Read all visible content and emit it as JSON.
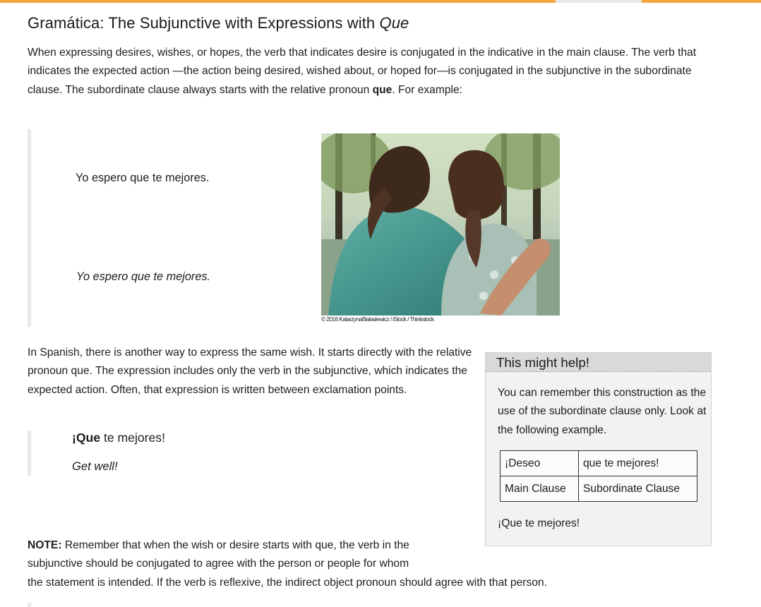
{
  "progress": {
    "fraction": 0.73,
    "accent": "#f5a53f",
    "track": "#e7e7e7"
  },
  "page": {
    "title_main": "Gramática: The Subjunctive with Expressions with ",
    "title_em": "Que",
    "intro_1": "When expressing desires, wishes, or hopes, the verb that indicates desire is conjugated in the indicative in the main clause. The verb that indicates the expected action —the action being desired, wished about, or hoped for—is conjugated in the subjunctive in the subordinate clause. The subordinate clause always starts with the relative pronoun ",
    "intro_bold": "que",
    "intro_2": ". For example:",
    "example_spanish": "Yo espero que te mejores.",
    "example_italic": "Yo espero que te mejores.",
    "photo_credit": "© 2016 KatarzynaBialasiewicz / iStock / Thinkstock",
    "para2": "In Spanish, there is another way to express the same wish. It starts directly with the relative pronoun que. The expression includes only the verb in the subjunctive, which indicates the expected action. Often, that expression is written between exclamation points.",
    "que_bold": "¡Que",
    "que_rest": " te mejores!",
    "get_well": "Get well!",
    "note_label": "NOTE:",
    "note_line_1": " Remember that when the wish or desire starts with que, the verb in the",
    "note_line_2": "subjunctive should be conjugated to agree with the person or people for whom",
    "note_line_3": "the statement is intended. If the verb is reflexive, the indirect object pronoun should agree with that person."
  },
  "help_box": {
    "title": "This might help!",
    "body": "You can remember this construction as the use of the subordinate clause only. Look at the following example.",
    "table": [
      [
        "¡Deseo",
        "que te mejores!"
      ],
      [
        "Main Clause",
        "Subordinate Clause"
      ]
    ],
    "footer": "¡Que te mejores!"
  }
}
